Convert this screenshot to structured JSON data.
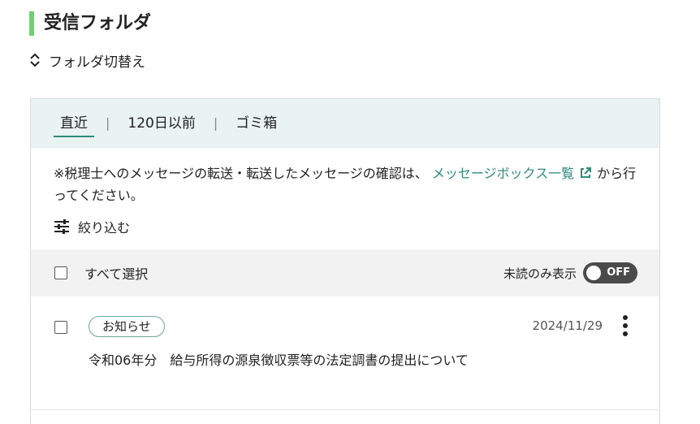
{
  "page_title": "受信フォルダ",
  "folder_switch": {
    "icon": "chevron-up-down-icon",
    "label": "フォルダ切替え"
  },
  "tabs": [
    {
      "label": "直近",
      "active": true
    },
    {
      "label": "120日以前",
      "active": false
    },
    {
      "label": "ゴミ箱",
      "active": false
    }
  ],
  "tab_separator": "|",
  "notice": {
    "text_before": "※税理士へのメッセージの転送・転送したメッセージの確認は、",
    "link_text": "メッセージボックス一覧",
    "link_icon": "external-link-icon",
    "text_after": "から行ってください。"
  },
  "filter": {
    "icon": "sliders-icon",
    "label": "絞り込む"
  },
  "select_bar": {
    "select_all_label": "すべて選択",
    "unread_only_label": "未読のみ表示",
    "toggle_state": "OFF"
  },
  "messages": [
    {
      "badge": "お知らせ",
      "date": "2024/11/29",
      "subject": "令和06年分　給与所得の源泉徴収票等の法定調書の提出について"
    }
  ],
  "colors": {
    "accent_green": "#6fcf73",
    "link_teal": "#2f8a7a",
    "tab_bar_bg": "#e8f3f2",
    "select_bar_bg": "#f2f2f2",
    "toggle_bg": "#4a4a4a"
  }
}
